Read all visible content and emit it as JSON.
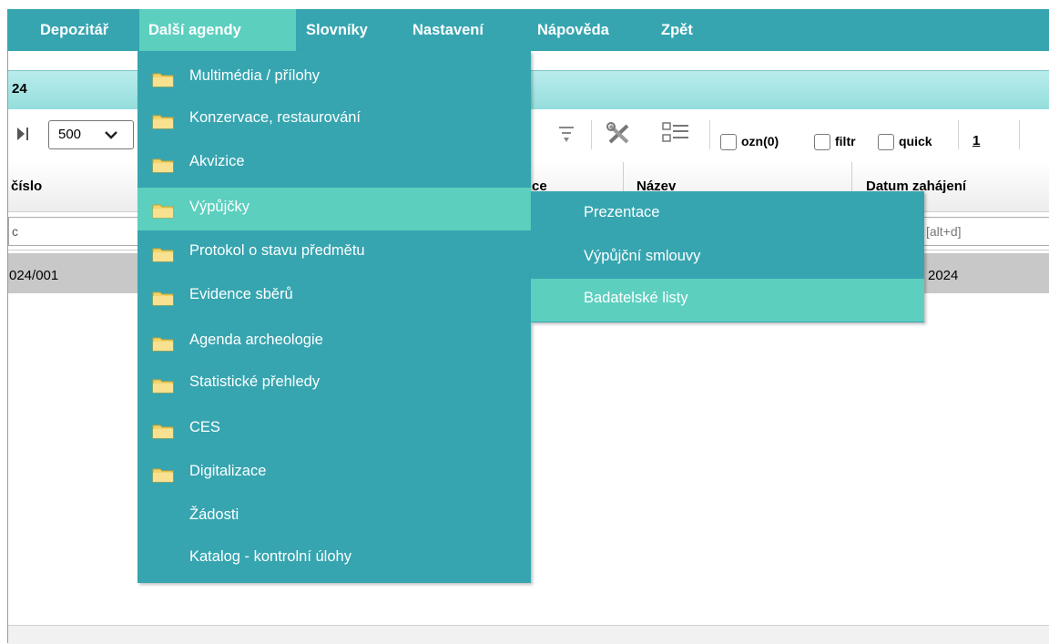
{
  "menubar": {
    "items": [
      {
        "label": "Depozitář"
      },
      {
        "label": "Další agendy",
        "active": true
      },
      {
        "label": "Slovníky"
      },
      {
        "label": "Nastavení"
      },
      {
        "label": "Nápověda"
      },
      {
        "label": "Zpět"
      }
    ]
  },
  "title_strip": {
    "text": "24"
  },
  "toolbar": {
    "page_size": "500",
    "checkbox_ozn": "ozn(0)",
    "checkbox_filtr": "filtr",
    "checkbox_quick": "quick",
    "page_number": "1"
  },
  "table": {
    "headers": [
      "číslo",
      "ce",
      "Název",
      "Datum zahájení"
    ],
    "filter_values": [
      "c",
      "[alt+d]"
    ],
    "rows": [
      {
        "cislo": "024/001",
        "datum": "2024"
      }
    ]
  },
  "dropdown": {
    "items": [
      {
        "label": "Multimédia / přílohy",
        "icon": "folder-icon"
      },
      {
        "label": "Konzervace, restaurování",
        "icon": "folder-icon"
      },
      {
        "label": "Akvizice",
        "icon": "folder-icon"
      },
      {
        "label": "Výpůjčky",
        "icon": "folder-icon",
        "highlighted": true
      },
      {
        "label": "Protokol o stavu předmětu",
        "icon": "folder-icon"
      },
      {
        "label": "Evidence sběrů",
        "icon": "folder-icon"
      },
      {
        "label": "Agenda archeologie",
        "icon": "folder-icon"
      },
      {
        "label": "Statistické přehledy",
        "icon": "folder-icon"
      },
      {
        "label": "CES",
        "icon": "folder-icon"
      },
      {
        "label": "Digitalizace",
        "icon": "folder-icon"
      },
      {
        "label": "Žádosti"
      },
      {
        "label": "Katalog - kontrolní úlohy"
      }
    ]
  },
  "submenu": {
    "items": [
      {
        "label": "Prezentace"
      },
      {
        "label": "Výpůjční smlouvy"
      },
      {
        "label": "Badatelské listy",
        "highlighted": true
      }
    ]
  },
  "colors": {
    "menu_bg": "#36a5b0",
    "menu_highlight": "#5ccfbf",
    "title_strip": "#a3e2e1",
    "row_selected": "#c8c8c8"
  }
}
